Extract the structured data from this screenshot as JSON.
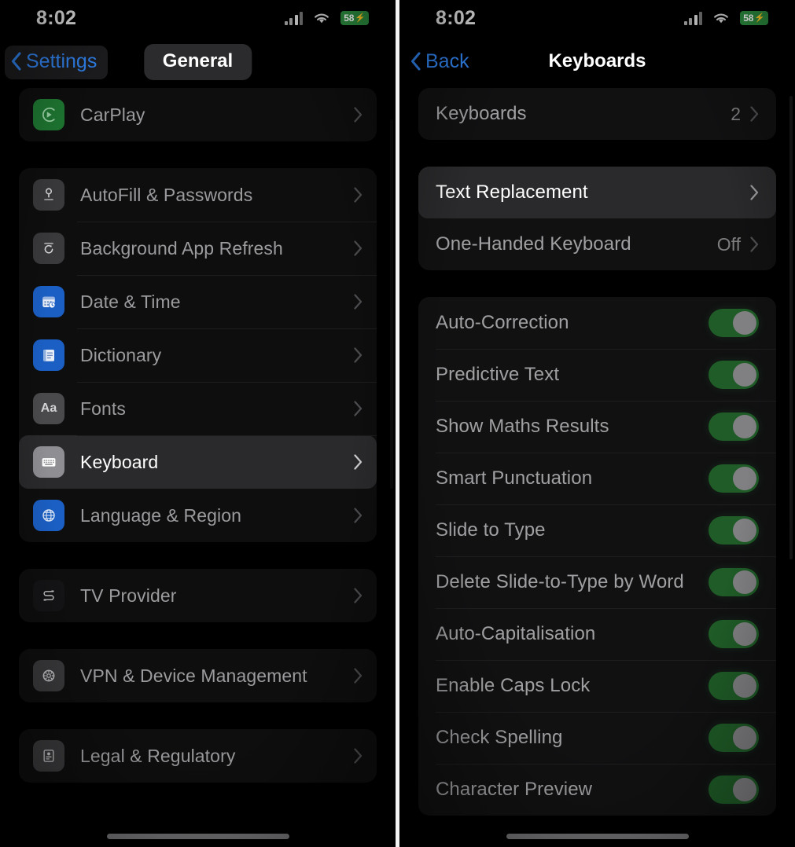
{
  "status_bar": {
    "time": "8:02",
    "battery_percent": "58",
    "battery_charging_glyph": "⚡",
    "signal_icon": "cellular-signal-icon",
    "wifi_icon": "wifi-icon",
    "battery_color": "#2b8a3e"
  },
  "left_panel": {
    "back_label": "Settings",
    "title": "General",
    "groups": [
      {
        "rows": [
          {
            "label": "CarPlay",
            "icon": "carplay-icon",
            "icon_bg": "#1f7a33",
            "accessory": "chevron-right-icon",
            "highlighted": false
          }
        ]
      },
      {
        "rows": [
          {
            "label": "AutoFill & Passwords",
            "icon": "key-icon",
            "icon_bg": "#3a3a3c",
            "accessory": "chevron-right-icon",
            "highlighted": false
          },
          {
            "label": "Background App Refresh",
            "icon": "refresh-icon",
            "icon_bg": "#3a3a3c",
            "accessory": "chevron-right-icon",
            "highlighted": false
          },
          {
            "label": "Date & Time",
            "icon": "calendar-clock-icon",
            "icon_bg": "#1b5fc4",
            "accessory": "chevron-right-icon",
            "highlighted": false
          },
          {
            "label": "Dictionary",
            "icon": "book-icon",
            "icon_bg": "#1b5fc4",
            "accessory": "chevron-right-icon",
            "highlighted": false
          },
          {
            "label": "Fonts",
            "icon": "fonts-aa-icon",
            "icon_bg": "#4a4a4c",
            "accessory": "chevron-right-icon",
            "highlighted": false
          },
          {
            "label": "Keyboard",
            "icon": "keyboard-icon",
            "icon_bg": "#8e8e93",
            "accessory": "chevron-right-icon",
            "highlighted": true
          },
          {
            "label": "Language & Region",
            "icon": "globe-icon",
            "icon_bg": "#1b5fc4",
            "accessory": "chevron-right-icon",
            "highlighted": false
          }
        ]
      },
      {
        "rows": [
          {
            "label": "TV Provider",
            "icon": "tv-provider-icon",
            "icon_bg": "#141416",
            "accessory": "chevron-right-icon",
            "highlighted": false
          }
        ]
      },
      {
        "rows": [
          {
            "label": "VPN & Device Management",
            "icon": "gear-icon",
            "icon_bg": "#3a3a3c",
            "accessory": "chevron-right-icon",
            "highlighted": false
          }
        ]
      },
      {
        "rows": [
          {
            "label": "Legal & Regulatory",
            "icon": "document-person-icon",
            "icon_bg": "#3a3a3c",
            "accessory": "chevron-right-icon",
            "highlighted": false
          }
        ]
      }
    ]
  },
  "right_panel": {
    "back_label": "Back",
    "title": "Keyboards",
    "group_1": [
      {
        "label": "Keyboards",
        "value": "2",
        "accessory": "chevron-right-icon",
        "highlighted": false
      }
    ],
    "group_2": [
      {
        "label": "Text Replacement",
        "value": "",
        "accessory": "chevron-right-icon",
        "highlighted": true
      },
      {
        "label": "One-Handed Keyboard",
        "value": "Off",
        "accessory": "chevron-right-icon",
        "highlighted": false
      }
    ],
    "group_3": [
      {
        "label": "Auto-Correction",
        "toggle": "on"
      },
      {
        "label": "Predictive Text",
        "toggle": "on"
      },
      {
        "label": "Show Maths Results",
        "toggle": "on"
      },
      {
        "label": "Smart Punctuation",
        "toggle": "on"
      },
      {
        "label": "Slide to Type",
        "toggle": "on"
      },
      {
        "label": "Delete Slide-to-Type by Word",
        "toggle": "on"
      },
      {
        "label": "Auto-Capitalisation",
        "toggle": "on"
      },
      {
        "label": "Enable Caps Lock",
        "toggle": "on"
      },
      {
        "label": "Check Spelling",
        "toggle": "on"
      },
      {
        "label": "Character Preview",
        "toggle": "on"
      }
    ]
  },
  "colors": {
    "accent_blue": "#2f7fe8",
    "toggle_on_green": "#1f5c27",
    "toggle_knob": "#808083",
    "highlight_bg": "#2a2a2c"
  }
}
